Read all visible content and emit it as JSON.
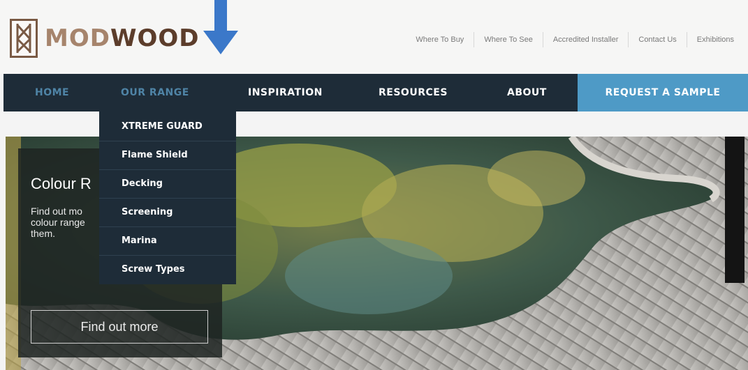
{
  "brand": {
    "name_part1": "MOD",
    "name_part2": "WOOD"
  },
  "annotation": {
    "arrow_color": "#3b78c9"
  },
  "top_links": [
    "Where To Buy",
    "Where To See",
    "Accredited Installer",
    "Contact Us",
    "Exhibitions"
  ],
  "nav": {
    "items": [
      "HOME",
      "OUR RANGE",
      "INSPIRATION",
      "RESOURCES",
      "ABOUT"
    ],
    "cta": "REQUEST A SAMPLE",
    "colors": {
      "bar": "#1e2c38",
      "muted": "#4f84a6",
      "cta": "#4e9ac6"
    }
  },
  "dropdown": {
    "items": [
      "XTREME GUARD",
      "Flame Shield",
      "Decking",
      "Screening",
      "Marina",
      "Screw Types"
    ]
  },
  "hero": {
    "title": "Colour R",
    "text_lines": [
      "Find out mo",
      "colour range",
      "them."
    ],
    "button": "Find out more"
  },
  "icons": {
    "logo": "modwood-logo-icon",
    "arrow": "arrow-down-icon"
  }
}
